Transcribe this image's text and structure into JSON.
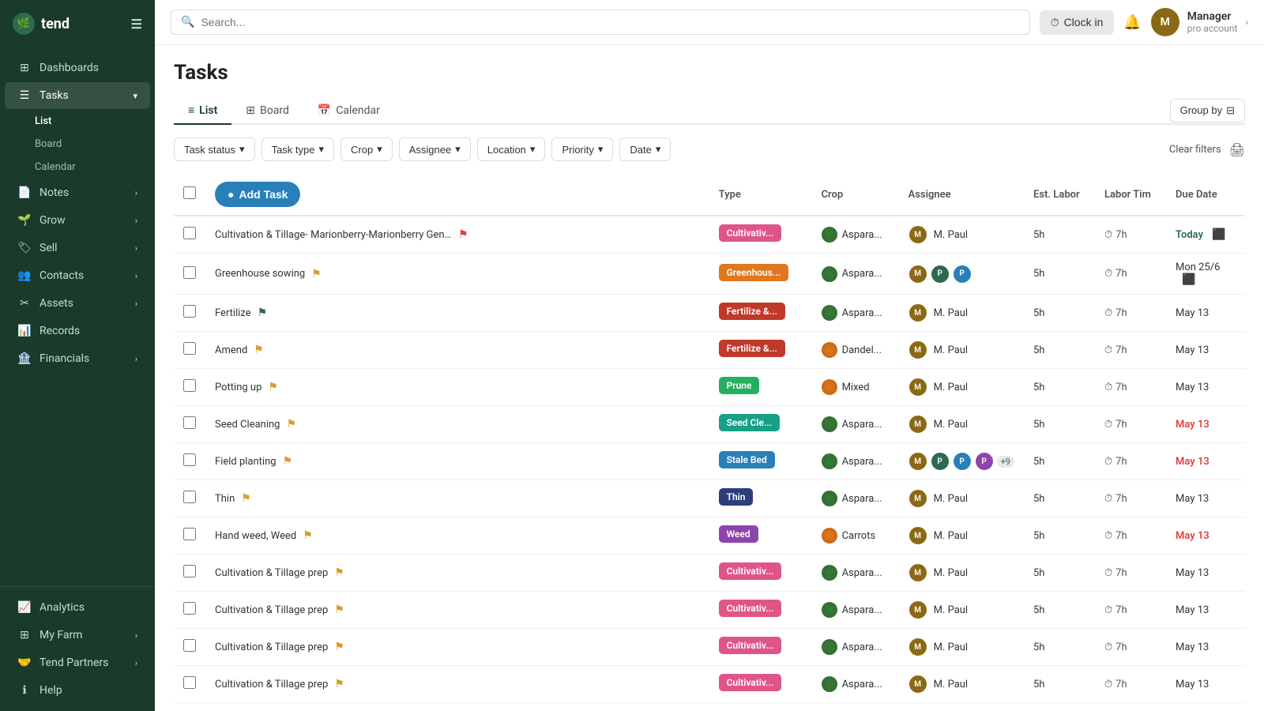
{
  "app": {
    "logo_text": "tend",
    "logo_icon": "🌿"
  },
  "sidebar": {
    "nav_items": [
      {
        "id": "dashboards",
        "label": "Dashboards",
        "icon": "⊞",
        "has_children": false
      },
      {
        "id": "tasks",
        "label": "Tasks",
        "icon": "☰",
        "has_children": true,
        "active": true
      },
      {
        "id": "notes",
        "label": "Notes",
        "icon": "📄",
        "has_children": true
      },
      {
        "id": "grow",
        "label": "Grow",
        "icon": "🌱",
        "has_children": true
      },
      {
        "id": "sell",
        "label": "Sell",
        "icon": "🏷",
        "has_children": true
      },
      {
        "id": "contacts",
        "label": "Contacts",
        "icon": "👥",
        "has_children": true
      },
      {
        "id": "assets",
        "label": "Assets",
        "icon": "✂",
        "has_children": true
      },
      {
        "id": "records",
        "label": "Records",
        "icon": "📊",
        "has_children": false
      },
      {
        "id": "financials",
        "label": "Financials",
        "icon": "🏦",
        "has_children": true
      }
    ],
    "sub_items": [
      {
        "id": "list",
        "label": "List",
        "active": true
      },
      {
        "id": "board",
        "label": "Board"
      },
      {
        "id": "calendar",
        "label": "Calendar"
      }
    ],
    "bottom_items": [
      {
        "id": "analytics",
        "label": "Analytics",
        "icon": "📈"
      },
      {
        "id": "my-farm",
        "label": "My Farm",
        "icon": "⊞",
        "has_children": true
      },
      {
        "id": "tend-partners",
        "label": "Tend Partners",
        "icon": "🤝",
        "has_children": true
      },
      {
        "id": "help",
        "label": "Help",
        "icon": "ℹ"
      }
    ]
  },
  "topbar": {
    "search_placeholder": "Search...",
    "clock_btn_label": "Clock in",
    "user_name": "Manager",
    "user_role": "pro account"
  },
  "page": {
    "title": "Tasks",
    "tabs": [
      "List",
      "Board",
      "Calendar"
    ],
    "active_tab": "List",
    "group_by_label": "Group by"
  },
  "filters": {
    "items": [
      "Task status",
      "Task type",
      "Crop",
      "Assignee",
      "Location",
      "Priority",
      "Date"
    ],
    "clear_label": "Clear filters"
  },
  "table": {
    "headers": [
      "",
      "Add Task",
      "Type",
      "Crop",
      "Assignee",
      "Est. Labor",
      "Labor Tim",
      "Due Date"
    ],
    "add_task_label": "Add Task",
    "rows": [
      {
        "id": 1,
        "name": "Cultivation & Tillage- Marionberry-Marionberry Generic - Ngu...",
        "flag": "red",
        "type": "Cultivativ...",
        "type_class": "badge-cultivate",
        "crop": "Aspara...",
        "crop_color": "green",
        "assignee": "M. Paul",
        "assignee_count": 1,
        "est_labor": "5h",
        "labor_time": "7h",
        "due_date": "Today",
        "due_class": "due-today",
        "has_subtask": true
      },
      {
        "id": 2,
        "name": "Greenhouse sowing",
        "flag": "yellow",
        "type": "Greenhous...",
        "type_class": "badge-greenhouse",
        "crop": "Aspara...",
        "crop_color": "green",
        "assignee": "M. Paul",
        "assignee_count": 3,
        "est_labor": "5h",
        "labor_time": "7h",
        "due_date": "Mon 25/6",
        "due_class": "due-normal",
        "has_subtask": true
      },
      {
        "id": 3,
        "name": "Fertilize",
        "flag": "green",
        "type": "Fertilize &...",
        "type_class": "badge-fertilize",
        "crop": "Aspara...",
        "crop_color": "green",
        "assignee": "M. Paul",
        "assignee_count": 1,
        "est_labor": "5h",
        "labor_time": "7h",
        "due_date": "May 13",
        "due_class": "due-normal",
        "has_subtask": false
      },
      {
        "id": 4,
        "name": "Amend",
        "flag": "yellow",
        "type": "Fertilize &...",
        "type_class": "badge-fertilize",
        "crop": "Dandel...",
        "crop_color": "orange",
        "assignee": "M. Paul",
        "assignee_count": 1,
        "est_labor": "5h",
        "labor_time": "7h",
        "due_date": "May 13",
        "due_class": "due-normal",
        "has_subtask": false
      },
      {
        "id": 5,
        "name": "Potting up",
        "flag": "yellow",
        "type": "Prune",
        "type_class": "badge-prune",
        "crop": "Mixed",
        "crop_color": "orange",
        "assignee": "M. Paul",
        "assignee_count": 1,
        "est_labor": "5h",
        "labor_time": "7h",
        "due_date": "May 13",
        "due_class": "due-normal",
        "has_subtask": false
      },
      {
        "id": 6,
        "name": "Seed Cleaning",
        "flag": "yellow",
        "type": "Seed Cle...",
        "type_class": "badge-seed",
        "crop": "Aspara...",
        "crop_color": "green",
        "assignee": "M. Paul",
        "assignee_count": 1,
        "est_labor": "5h",
        "labor_time": "7h",
        "due_date": "May 13",
        "due_class": "due-overdue",
        "has_subtask": false
      },
      {
        "id": 7,
        "name": "Field planting",
        "flag": "yellow",
        "type": "Stale Bed",
        "type_class": "badge-stale",
        "crop": "Aspara...",
        "crop_color": "green",
        "assignee": "M. Paul",
        "assignee_count": 4,
        "extra_count": "+9",
        "est_labor": "5h",
        "labor_time": "7h",
        "due_date": "May 13",
        "due_class": "due-overdue",
        "has_subtask": false
      },
      {
        "id": 8,
        "name": "Thin",
        "flag": "yellow",
        "type": "Thin",
        "type_class": "badge-thin",
        "crop": "Aspara...",
        "crop_color": "green",
        "assignee": "M. Paul",
        "assignee_count": 1,
        "est_labor": "5h",
        "labor_time": "7h",
        "due_date": "May 13",
        "due_class": "due-normal",
        "has_subtask": false
      },
      {
        "id": 9,
        "name": "Hand weed, Weed",
        "flag": "yellow",
        "type": "Weed",
        "type_class": "badge-weed",
        "crop": "Carrots",
        "crop_color": "orange",
        "assignee": "M. Paul",
        "assignee_count": 1,
        "est_labor": "5h",
        "labor_time": "7h",
        "due_date": "May 13",
        "due_class": "due-overdue",
        "has_subtask": false
      },
      {
        "id": 10,
        "name": "Cultivation & Tillage prep",
        "flag": "yellow",
        "type": "Cultivativ...",
        "type_class": "badge-cultivate",
        "crop": "Aspara...",
        "crop_color": "green",
        "assignee": "M. Paul",
        "assignee_count": 1,
        "est_labor": "5h",
        "labor_time": "7h",
        "due_date": "May 13",
        "due_class": "due-normal",
        "has_subtask": false
      },
      {
        "id": 11,
        "name": "Cultivation & Tillage prep",
        "flag": "yellow",
        "type": "Cultivativ...",
        "type_class": "badge-cultivate",
        "crop": "Aspara...",
        "crop_color": "green",
        "assignee": "M. Paul",
        "assignee_count": 1,
        "est_labor": "5h",
        "labor_time": "7h",
        "due_date": "May 13",
        "due_class": "due-normal",
        "has_subtask": false
      },
      {
        "id": 12,
        "name": "Cultivation & Tillage prep",
        "flag": "yellow",
        "type": "Cultivativ...",
        "type_class": "badge-cultivate",
        "crop": "Aspara...",
        "crop_color": "green",
        "assignee": "M. Paul",
        "assignee_count": 1,
        "est_labor": "5h",
        "labor_time": "7h",
        "due_date": "May 13",
        "due_class": "due-normal",
        "has_subtask": false
      },
      {
        "id": 13,
        "name": "Cultivation & Tillage prep",
        "flag": "yellow",
        "type": "Cultivativ...",
        "type_class": "badge-cultivate",
        "crop": "Aspara...",
        "crop_color": "green",
        "assignee": "M. Paul",
        "assignee_count": 1,
        "est_labor": "5h",
        "labor_time": "7h",
        "due_date": "May 13",
        "due_class": "due-normal",
        "has_subtask": false
      }
    ]
  }
}
